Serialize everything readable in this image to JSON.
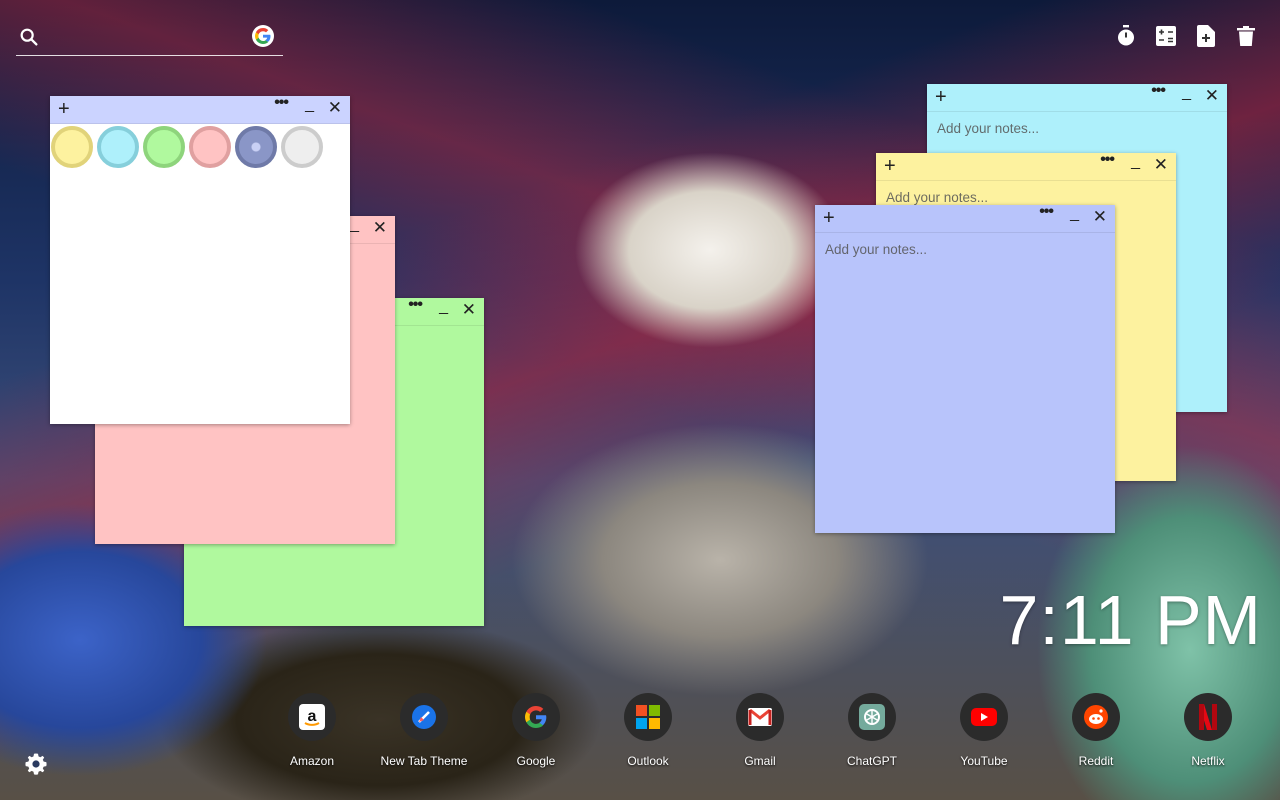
{
  "search": {
    "placeholder": "",
    "value": ""
  },
  "toolbar": {
    "items": [
      {
        "name": "timer-icon"
      },
      {
        "name": "calculator-icon"
      },
      {
        "name": "new-note-icon"
      },
      {
        "name": "trash-icon"
      }
    ]
  },
  "notes": {
    "white": {
      "color": "#ffffff",
      "bar_color": "#cbd3ff",
      "add": "+",
      "more": "•••",
      "minimize": "_",
      "close": "✕"
    },
    "pink": {
      "color": "#ffc3c3",
      "more": "•••",
      "minimize": "_",
      "close": "✕"
    },
    "green": {
      "color": "#b0f99e",
      "more": "•••",
      "minimize": "_",
      "close": "✕"
    },
    "cyan": {
      "color": "#aef0fb",
      "add": "+",
      "more": "•••",
      "minimize": "_",
      "close": "✕",
      "placeholder": "Add your notes..."
    },
    "yellow": {
      "color": "#fdf29f",
      "add": "+",
      "more": "•••",
      "minimize": "_",
      "close": "✕",
      "placeholder": "Add your notes..."
    },
    "blue": {
      "color": "#b8c4fb",
      "add": "+",
      "more": "•••",
      "minimize": "_",
      "close": "✕",
      "placeholder": "Add your notes..."
    }
  },
  "palette": [
    {
      "name": "yellow",
      "fill": "#fdf29f",
      "ring": "#e1d37a"
    },
    {
      "name": "cyan",
      "fill": "#aef0fb",
      "ring": "#86cfdb"
    },
    {
      "name": "green",
      "fill": "#b0f99e",
      "ring": "#8ed47c"
    },
    {
      "name": "pink",
      "fill": "#ffc3c3",
      "ring": "#e0a0a0"
    },
    {
      "name": "blue",
      "fill": "#8a96c7",
      "ring": "#6f7aa8",
      "selected": true
    },
    {
      "name": "gray",
      "fill": "#eeeeee",
      "ring": "#cccccc"
    }
  ],
  "clock": {
    "time": "7:11 PM"
  },
  "shortcuts": [
    {
      "label": "Amazon",
      "icon": "amazon-icon"
    },
    {
      "label": "New Tab Theme",
      "icon": "new-tab-theme-icon"
    },
    {
      "label": "Google",
      "icon": "google-icon"
    },
    {
      "label": "Outlook",
      "icon": "outlook-icon"
    },
    {
      "label": "Gmail",
      "icon": "gmail-icon"
    },
    {
      "label": "ChatGPT",
      "icon": "chatgpt-icon"
    },
    {
      "label": "YouTube",
      "icon": "youtube-icon"
    },
    {
      "label": "Reddit",
      "icon": "reddit-icon"
    },
    {
      "label": "Netflix",
      "icon": "netflix-icon"
    }
  ]
}
